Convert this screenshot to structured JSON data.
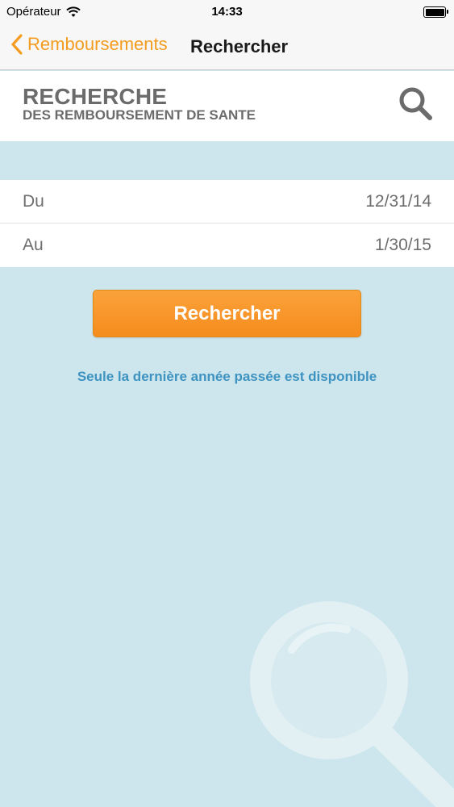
{
  "status_bar": {
    "carrier": "Opérateur",
    "time": "14:33",
    "icons": [
      "wifi-icon",
      "battery-icon"
    ]
  },
  "nav": {
    "back_label": "Remboursements",
    "title": "Rechercher",
    "accent_color": "#f39c1f"
  },
  "header": {
    "title": "RECHERCHE",
    "subtitle": "DES REMBOURSEMENT DE SANTE",
    "icon": "search-icon"
  },
  "dates": [
    {
      "label": "Du",
      "value": "12/31/14"
    },
    {
      "label": "Au",
      "value": "1/30/15"
    }
  ],
  "search_button": {
    "label": "Rechercher",
    "color": "#f7941e"
  },
  "info": {
    "text": "Seule la dernière année passée est disponible",
    "color": "#3e93c1"
  },
  "background": {
    "color": "#cde5ec",
    "icon": "magnifier-watermark-icon"
  }
}
